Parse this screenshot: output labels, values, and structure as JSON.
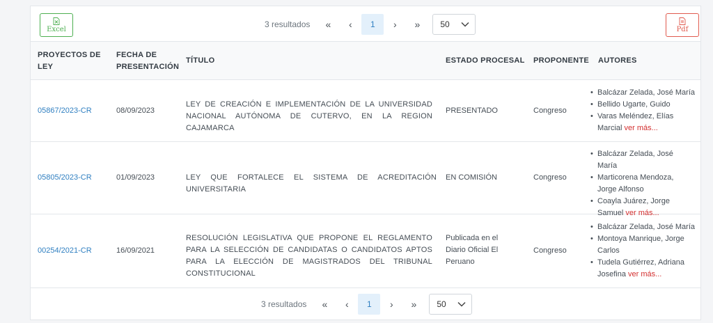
{
  "toolbar": {
    "excel_label": "Excel",
    "pdf_label": "Pdf"
  },
  "pager": {
    "count": "3 resultados",
    "first": "«",
    "prev": "‹",
    "page": "1",
    "next": "›",
    "last": "»",
    "page_size": "50"
  },
  "table": {
    "headers": {
      "proyectos_l1": "PROYECTOS DE",
      "proyectos_l2": "LEY",
      "fecha_l1": "FECHA DE",
      "fecha_l2": "PRESENTACIÓN",
      "titulo": "TÍTULO",
      "estado": "ESTADO PROCESAL",
      "proponente": "PROPONENTE",
      "autores": "AUTORES"
    },
    "rows": [
      {
        "code": "05867/2023-CR",
        "date": "08/09/2023",
        "title": "LEY DE CREACIÓN E IMPLEMENTACIÓN DE LA UNIVERSIDAD NACIONAL AUTÓNOMA DE CUTERVO, EN LA REGION CAJAMARCA",
        "status": "PRESENTADO",
        "proponent": "Congreso",
        "authors": [
          "Balcázar Zelada, José María",
          "Bellido Ugarte, Guido",
          "Varas Meléndez, Elías Marcial"
        ],
        "more": "ver más..."
      },
      {
        "code": "05805/2023-CR",
        "date": "01/09/2023",
        "title": "LEY QUE FORTALECE EL SISTEMA DE ACREDITACIÓN UNIVERSITARIA",
        "status": "EN COMISIÓN",
        "proponent": "Congreso",
        "authors": [
          "Balcázar Zelada, José María",
          "Marticorena Mendoza, Jorge Alfonso",
          "Coayla Juárez, Jorge Samuel"
        ],
        "more": "ver más..."
      },
      {
        "code": "00254/2021-CR",
        "date": "16/09/2021",
        "title": "RESOLUCIÓN LEGISLATIVA QUE PROPONE EL REGLAMENTO PARA LA SELECCIÓN DE CANDIDATAS O CANDIDATOS APTOS PARA LA ELECCIÓN DE MAGISTRADOS DEL TRIBUNAL CONSTITUCIONAL",
        "status": "Publicada en el Diario Oficial El Peruano",
        "proponent": "Congreso",
        "authors": [
          "Balcázar Zelada, José María",
          "Montoya Manrique, Jorge Carlos",
          "Tudela Gutiérrez, Adriana Josefina"
        ],
        "more": "ver más..."
      }
    ]
  }
}
